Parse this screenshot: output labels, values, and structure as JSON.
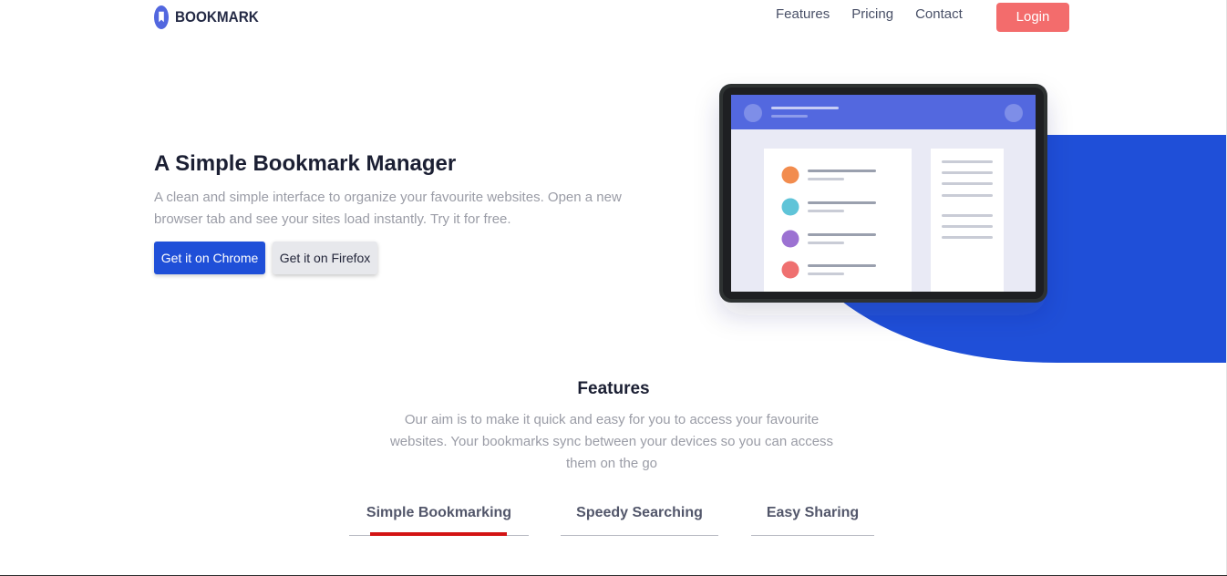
{
  "header": {
    "logo_text": "BOOKMARK",
    "nav": [
      "Features",
      "Pricing",
      "Contact"
    ],
    "login_label": "Login"
  },
  "hero": {
    "title": "A Simple Bookmark Manager",
    "description": "A clean and simple interface to organize your favourite websites. Open a new browser tab and see your sites load instantly. Try it for free.",
    "chrome_button": "Get it on Chrome",
    "firefox_button": "Get it on Firefox"
  },
  "features": {
    "title": "Features",
    "description": "Our aim is to make it quick and easy for you to access your favourite websites. Your bookmarks sync between your devices so you can access them on the go",
    "tabs": [
      {
        "label": "Simple Bookmarking",
        "active": true
      },
      {
        "label": "Speedy Searching",
        "active": false
      },
      {
        "label": "Easy Sharing",
        "active": false
      }
    ]
  },
  "colors": {
    "primary_blue": "#1f4fd8",
    "soft_red": "#f36c6c",
    "tab_active_underline": "#d31414",
    "illustration_header": "#5368df"
  },
  "illustration": {
    "list_dot_colors": [
      "#f28c4e",
      "#5fc4d8",
      "#9c72d2",
      "#ef7070"
    ]
  }
}
